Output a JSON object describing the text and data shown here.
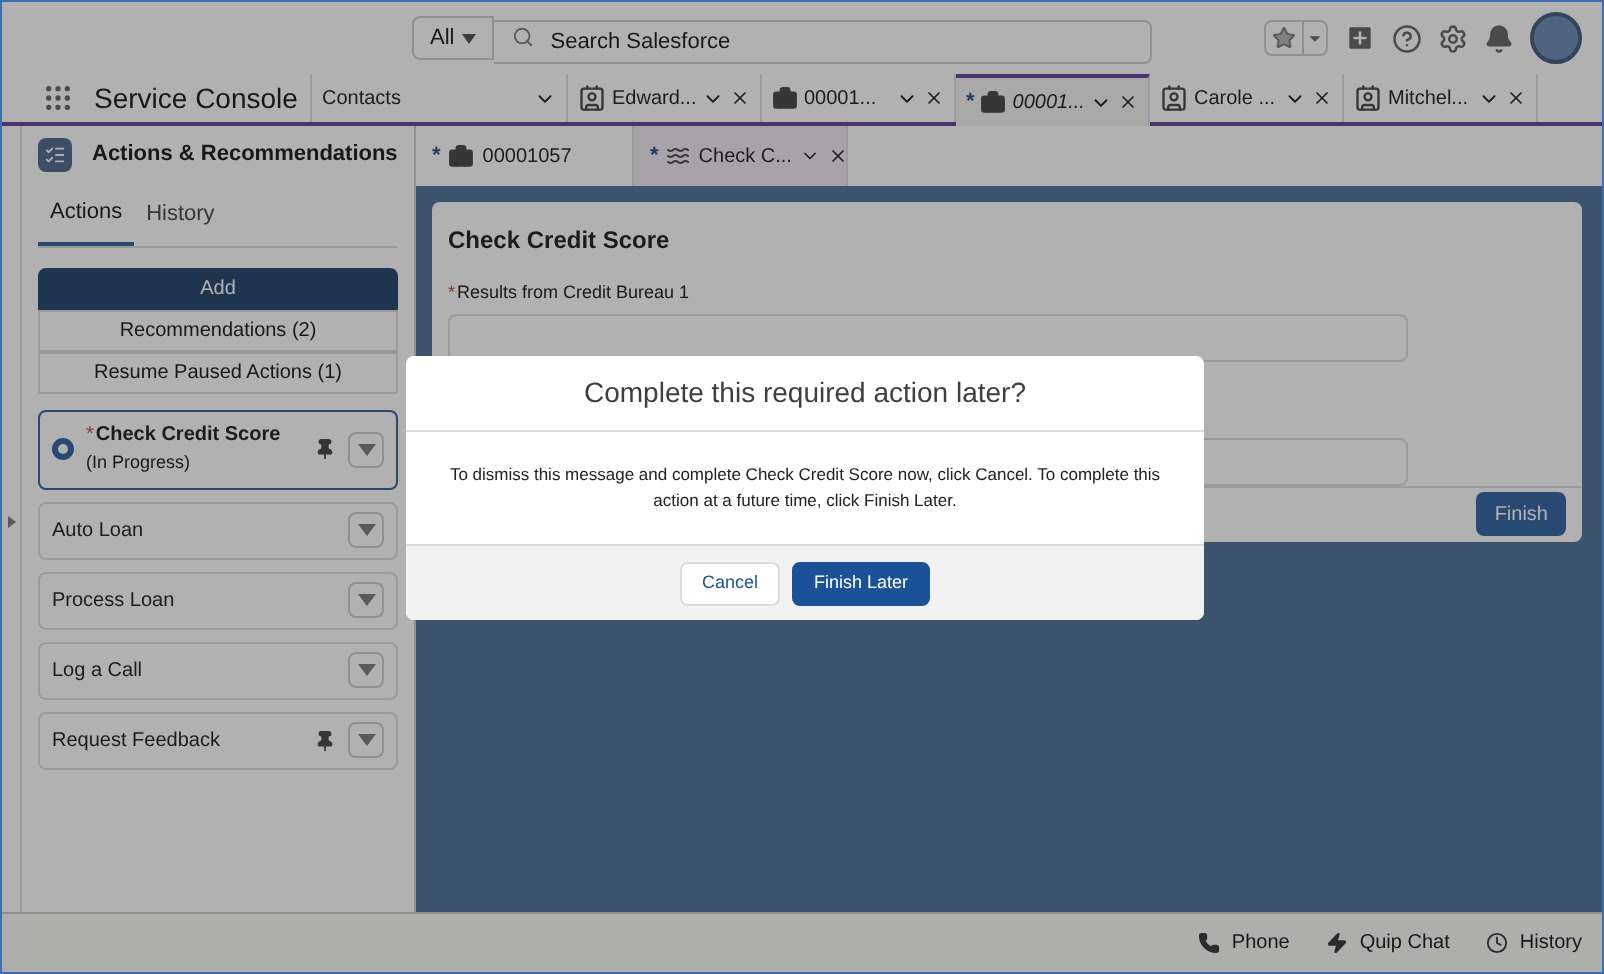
{
  "header": {
    "scope": "All",
    "search_placeholder": "Search Salesforce"
  },
  "app_name": "Service Console",
  "tabs": [
    {
      "kind": "object",
      "label": "Contacts",
      "selected": false,
      "closable": false
    },
    {
      "kind": "contact",
      "label": "Edward...",
      "selected": false,
      "closable": true
    },
    {
      "kind": "case",
      "label": "00001...",
      "selected": false,
      "closable": true
    },
    {
      "kind": "case",
      "label": "00001...",
      "selected": true,
      "closable": true,
      "unsaved_mark": "*"
    },
    {
      "kind": "contact",
      "label": "Carole ...",
      "selected": false,
      "closable": true
    },
    {
      "kind": "contact",
      "label": "Mitchel...",
      "selected": false,
      "closable": true
    }
  ],
  "sidebar": {
    "title": "Actions & Recommendations",
    "tabs": [
      {
        "label": "Actions",
        "selected": true
      },
      {
        "label": "History",
        "selected": false
      }
    ],
    "buttons": [
      {
        "kind": "primary",
        "label": "Add"
      },
      {
        "kind": "secondary",
        "label": "Recommendations (2)"
      },
      {
        "kind": "secondary",
        "label": "Resume Paused Actions (1)"
      }
    ],
    "actions": [
      {
        "name": "Check Credit Score",
        "required_mark": "*",
        "status": "(In Progress)",
        "active": true,
        "pinned": true
      },
      {
        "name": "Auto Loan",
        "active": false,
        "pinned": false
      },
      {
        "name": "Process Loan",
        "active": false,
        "pinned": false
      },
      {
        "name": "Log a Call",
        "active": false,
        "pinned": false
      },
      {
        "name": "Request Feedback",
        "active": false,
        "pinned": true
      }
    ]
  },
  "subtabs": [
    {
      "kind": "case",
      "label": "00001057",
      "unsaved_mark": "*",
      "selected": false
    },
    {
      "kind": "flow",
      "label": "Check C...",
      "unsaved_mark": "*",
      "selected": true
    }
  ],
  "card": {
    "title": "Check Credit Score",
    "field_label": "Results from Credit Bureau 1",
    "required_mark": "*",
    "finish_button": "Finish"
  },
  "modal": {
    "title": "Complete this required action later?",
    "message": "To dismiss this message and complete Check Credit Score now, click Cancel. To complete this action at a future time, click Finish Later.",
    "buttons": [
      {
        "kind": "neutral",
        "label": "Cancel"
      },
      {
        "kind": "brand",
        "label": "Finish Later"
      }
    ]
  },
  "utility_bar": [
    {
      "kind": "phone",
      "label": "Phone"
    },
    {
      "kind": "chat",
      "label": "Quip Chat"
    },
    {
      "kind": "history",
      "label": "History"
    }
  ]
}
